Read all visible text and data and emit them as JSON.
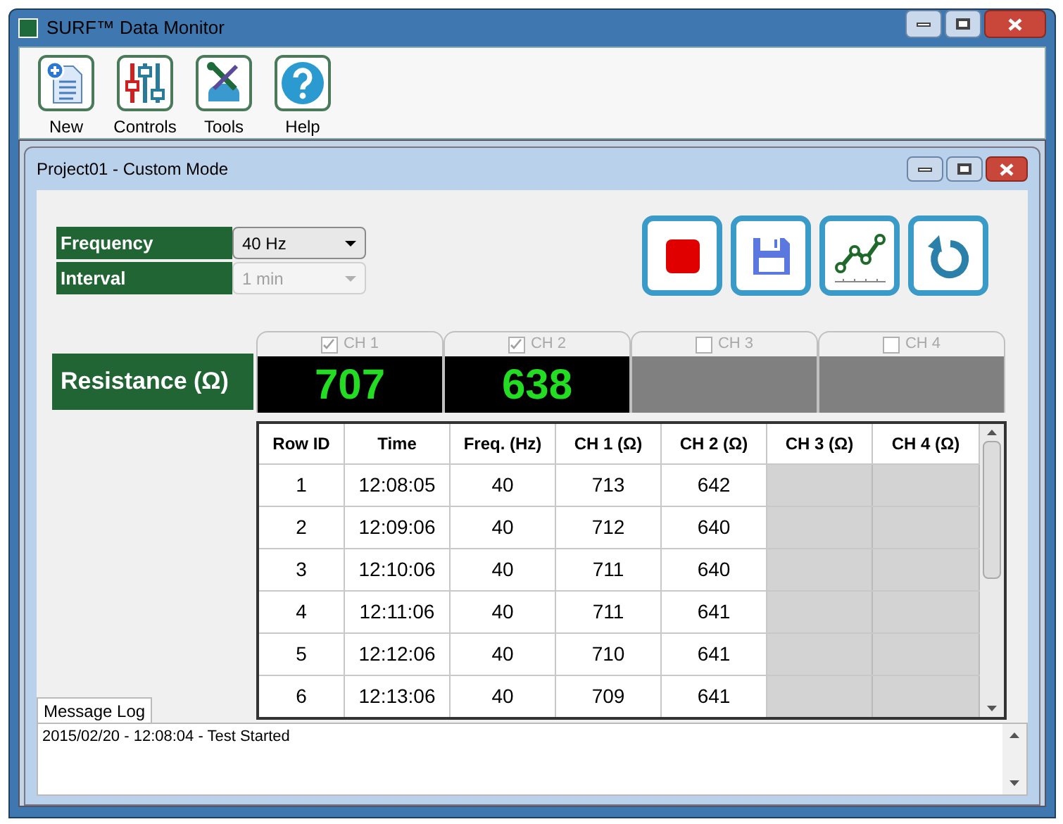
{
  "window": {
    "title": "SURF™ Data Monitor"
  },
  "toolbar": [
    {
      "label": "New",
      "kind": "new"
    },
    {
      "label": "Controls",
      "kind": "controls"
    },
    {
      "label": "Tools",
      "kind": "tools"
    },
    {
      "label": "Help",
      "kind": "help"
    }
  ],
  "child_window": {
    "title": "Project01 - Custom Mode"
  },
  "settings": [
    {
      "label": "Frequency",
      "value": "40 Hz",
      "disabled": false
    },
    {
      "label": "Interval",
      "value": "1 min",
      "disabled": true
    }
  ],
  "actions": [
    {
      "kind": "stop"
    },
    {
      "kind": "save"
    },
    {
      "kind": "chart"
    },
    {
      "kind": "refresh"
    }
  ],
  "reading_label": "Resistance (Ω)",
  "channels": [
    {
      "label": "CH 1",
      "checked": true,
      "value": "707"
    },
    {
      "label": "CH 2",
      "checked": true,
      "value": "638"
    },
    {
      "label": "CH 3",
      "checked": false
    },
    {
      "label": "CH 4",
      "checked": false
    }
  ],
  "table": {
    "columns": [
      "Row ID",
      "Time",
      "Freq. (Hz)",
      "CH 1 (Ω)",
      "CH 2 (Ω)",
      "CH 3 (Ω)",
      "CH 4 (Ω)"
    ],
    "rows": [
      [
        "1",
        "12:08:05",
        "40",
        "713",
        "642"
      ],
      [
        "2",
        "12:09:06",
        "40",
        "712",
        "640"
      ],
      [
        "3",
        "12:10:06",
        "40",
        "711",
        "640"
      ],
      [
        "4",
        "12:11:06",
        "40",
        "711",
        "641"
      ],
      [
        "5",
        "12:12:06",
        "40",
        "710",
        "641"
      ],
      [
        "6",
        "12:13:06",
        "40",
        "709",
        "641"
      ]
    ]
  },
  "message_log": {
    "title": "Message Log",
    "lines": [
      "2015/02/20 - 12:08:04 - Test Started"
    ]
  }
}
